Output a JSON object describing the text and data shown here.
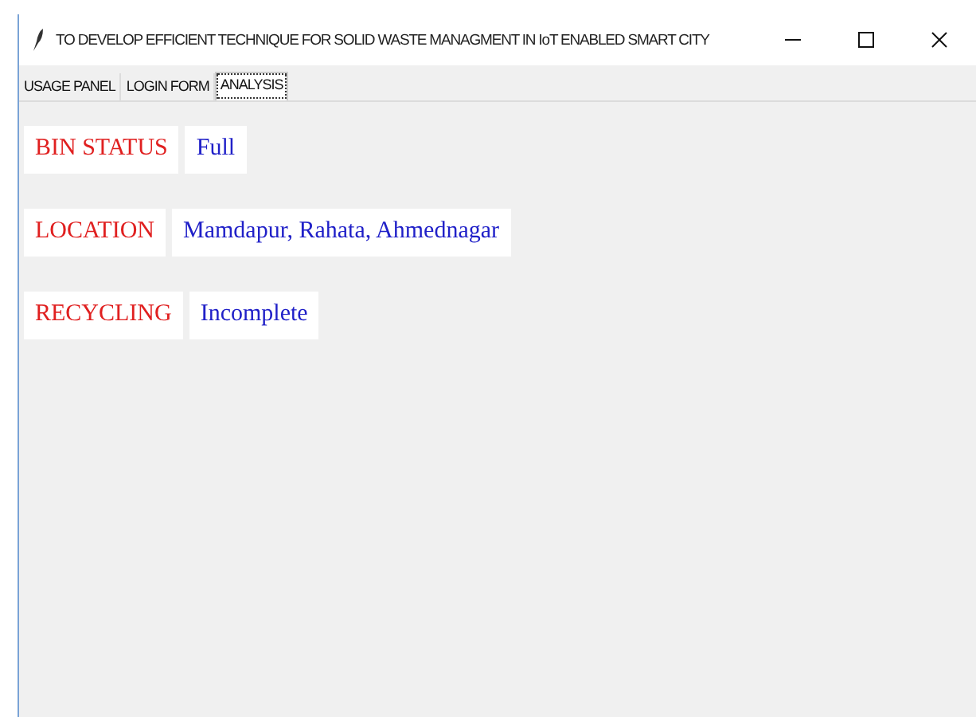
{
  "window": {
    "title": "TO DEVELOP EFFICIENT TECHNIQUE FOR SOLID WASTE MANAGMENT IN IoT ENABLED SMART CITY"
  },
  "tabs": [
    {
      "label": "USAGE PANEL",
      "selected": false
    },
    {
      "label": "LOGIN FORM",
      "selected": false
    },
    {
      "label": "ANALYSIS",
      "selected": true
    }
  ],
  "fields": [
    {
      "label": "BIN STATUS",
      "value": "Full"
    },
    {
      "label": "LOCATION",
      "value": "Mamdapur, Rahata, Ahmednagar"
    },
    {
      "label": "RECYCLING",
      "value": "Incomplete"
    }
  ]
}
